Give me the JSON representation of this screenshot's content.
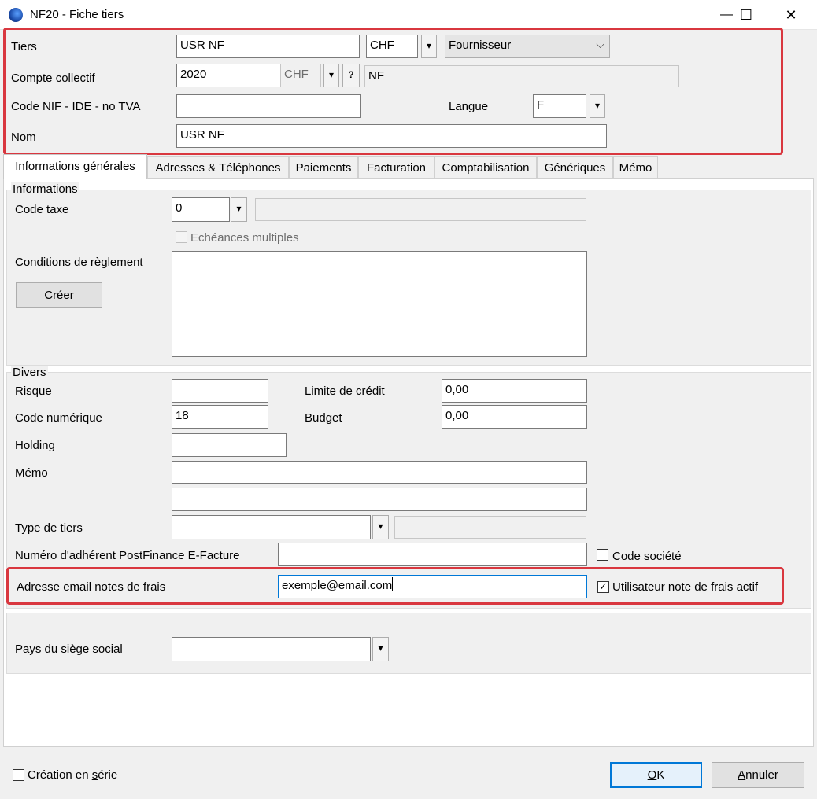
{
  "window": {
    "title": "NF20 - Fiche tiers",
    "minimize": "—",
    "maximize": "☐",
    "close": "✕"
  },
  "header": {
    "tiers_label": "Tiers",
    "tiers_value": "USR NF",
    "currency_value": "CHF",
    "type_value": "Fournisseur",
    "compte_label": "Compte collectif",
    "compte_value": "2020",
    "compte_currency": "CHF",
    "help_button": "?",
    "compte_desc": "NF",
    "nif_label": "Code NIF - IDE - no TVA",
    "nif_value": "",
    "langue_label": "Langue",
    "langue_value": "F",
    "nom_label": "Nom",
    "nom_value": "USR NF"
  },
  "tabs": [
    {
      "label": "Informations générales"
    },
    {
      "label": "Adresses & Téléphones"
    },
    {
      "label": "Paiements"
    },
    {
      "label": "Facturation"
    },
    {
      "label": "Comptabilisation"
    },
    {
      "label": "Génériques"
    },
    {
      "label": "Mémo"
    }
  ],
  "informations": {
    "group_title": "Informations",
    "code_taxe_label": "Code taxe",
    "code_taxe_value": "0",
    "code_taxe_desc": "",
    "echeances_label": "Echéances multiples",
    "conditions_label": "Conditions de règlement",
    "conditions_value": "",
    "creer_button": "Créer"
  },
  "divers": {
    "group_title": "Divers",
    "risque_label": "Risque",
    "risque_value": "",
    "limite_label": "Limite de crédit",
    "limite_value": "0,00",
    "code_num_label": "Code numérique",
    "code_num_value": "18",
    "budget_label": "Budget",
    "budget_value": "0,00",
    "holding_label": "Holding",
    "holding_value": "",
    "memo_label": "Mémo",
    "memo_value1": "",
    "memo_value2": "",
    "type_tiers_label": "Type de tiers",
    "type_tiers_value": "",
    "type_tiers_desc": "",
    "postfinance_label": "Numéro d'adhérent PostFinance E-Facture",
    "postfinance_value": "",
    "code_societe_label": "Code société",
    "email_label": "Adresse email notes de frais",
    "email_value": "exemple@email.com",
    "utilisateur_label": "Utilisateur note de frais actif"
  },
  "siege": {
    "pays_label": "Pays du siège social",
    "pays_value": ""
  },
  "footer": {
    "creation_serie_prefix": "Création en ",
    "creation_serie_underlined": "s",
    "creation_serie_suffix": "érie",
    "ok_underlined": "O",
    "ok_suffix": "K",
    "annuler_underlined": "A",
    "annuler_suffix": "nnuler"
  },
  "icons": {
    "dropdown": "▾",
    "chevron": "⌵",
    "check": "✓"
  },
  "colors": {
    "highlight": "#d9373f",
    "default_button": "#0078d7"
  }
}
